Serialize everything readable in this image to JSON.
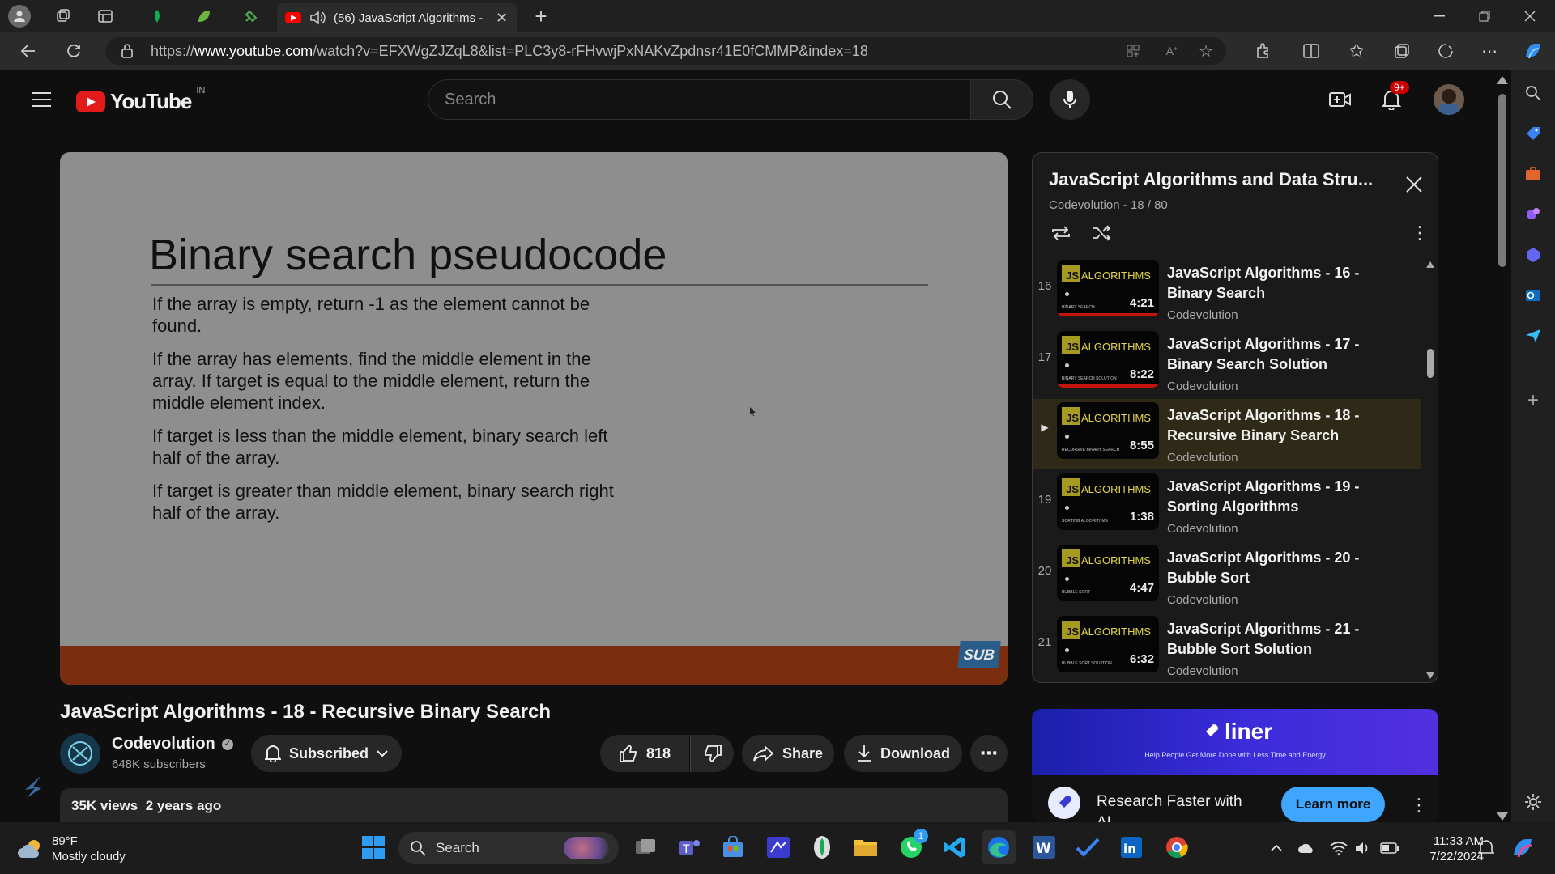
{
  "browser": {
    "tab_title": "(56) JavaScript Algorithms -",
    "url_prefix": "https://",
    "url_domain": "www.youtube.com",
    "url_rest": "/watch?v=EFXWgZJZqL8&list=PLC3y8-rFHvwjPxNAKvZpdnsr41E0fCMMP&index=18"
  },
  "youtube": {
    "logo_text": "YouTube",
    "region": "IN",
    "search_placeholder": "Search",
    "notification_count": "9+"
  },
  "slide": {
    "title": "Binary search pseudocode",
    "paragraphs": [
      "If the array is empty, return -1 as the element cannot be found.",
      "If the array has elements, find the middle element in the array. If target is equal to the middle element, return the middle element index.",
      "If target is less than the middle element, binary search left half of the array.",
      "If target is greater than middle element, binary search right half of the array."
    ],
    "badge": "SUB"
  },
  "video": {
    "title": "JavaScript Algorithms - 18 - Recursive Binary Search",
    "channel": "Codevolution",
    "subscribers": "648K subscribers",
    "subscribed_label": "Subscribed",
    "likes": "818",
    "share_label": "Share",
    "download_label": "Download",
    "views": "35K views",
    "age": "2 years ago"
  },
  "playlist": {
    "title": "JavaScript Algorithms and Data Stru...",
    "meta": "Codevolution - 18 / 80",
    "items": [
      {
        "index": "16",
        "title": "JavaScript Algorithms - 16 - Binary Search",
        "channel": "Codevolution",
        "duration": "4:21",
        "thumb_caption": "BINARY SEARCH",
        "watched": 1.0
      },
      {
        "index": "17",
        "title": "JavaScript Algorithms - 17 - Binary Search Solution",
        "channel": "Codevolution",
        "duration": "8:22",
        "thumb_caption": "BINARY SEARCH SOLUTION",
        "watched": 1.0
      },
      {
        "index": "▶",
        "title": "JavaScript Algorithms - 18 - Recursive Binary Search",
        "channel": "Codevolution",
        "duration": "8:55",
        "thumb_caption": "RECURSIVE BINARY SEARCH",
        "watched": 0
      },
      {
        "index": "19",
        "title": "JavaScript Algorithms - 19 - Sorting Algorithms",
        "channel": "Codevolution",
        "duration": "1:38",
        "thumb_caption": "SORTING ALGORITHMS",
        "watched": 0
      },
      {
        "index": "20",
        "title": "JavaScript Algorithms - 20 - Bubble Sort",
        "channel": "Codevolution",
        "duration": "4:47",
        "thumb_caption": "BUBBLE SORT",
        "watched": 0
      },
      {
        "index": "21",
        "title": "JavaScript Algorithms - 21 - Bubble Sort Solution",
        "channel": "Codevolution",
        "duration": "6:32",
        "thumb_caption": "BUBBLE SORT SOLUTION",
        "watched": 0
      }
    ],
    "thumb_js": "JS",
    "thumb_algo": "ALGORITHMS"
  },
  "ad": {
    "brand": "liner",
    "tagline": "Help People Get More Done with Less Time and Energy",
    "headline": "Research Faster with",
    "headline_cut": "AI",
    "cta": "Learn more"
  },
  "taskbar": {
    "temperature": "89°F",
    "weather": "Mostly cloudy",
    "search_label": "Search",
    "time": "11:33 AM",
    "date": "7/22/2024",
    "teams_badge": "1"
  },
  "colors": {
    "accent_red": "#c4120c",
    "edge_blue": "#1a73e8"
  }
}
